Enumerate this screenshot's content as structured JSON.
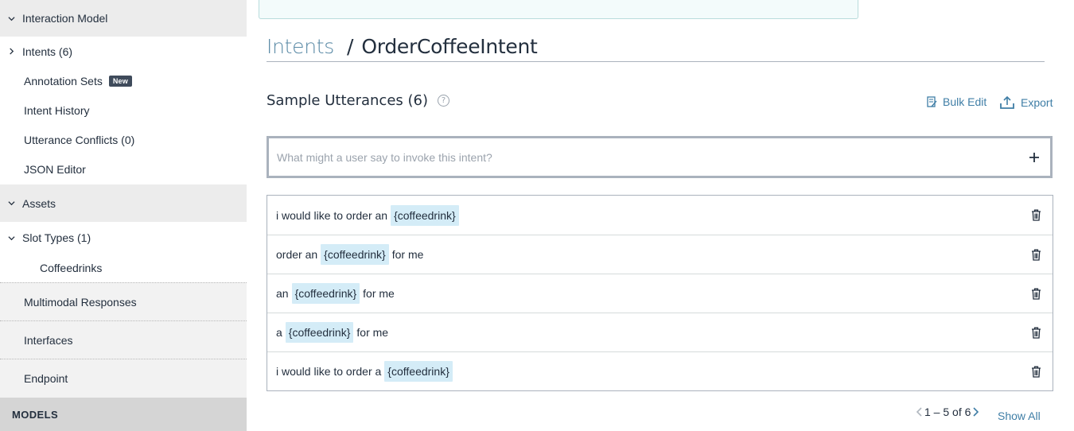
{
  "sidebar": {
    "interaction_model": "Interaction Model",
    "intents": "Intents (6)",
    "annotation_sets": "Annotation Sets",
    "new_badge": "New",
    "intent_history": "Intent History",
    "utterance_conflicts": "Utterance Conflicts (0)",
    "json_editor": "JSON Editor",
    "assets": "Assets",
    "slot_types": "Slot Types (1)",
    "coffeedrinks": "Coffeedrinks",
    "multimodal_responses": "Multimodal Responses",
    "interfaces": "Interfaces",
    "endpoint": "Endpoint",
    "models": "MODELS"
  },
  "breadcrumb": {
    "parent": "Intents",
    "separator": "/",
    "current": "OrderCoffeeIntent"
  },
  "utterances": {
    "title": "Sample Utterances (6)",
    "help": "?",
    "bulk_edit": "Bulk Edit",
    "export": "Export",
    "input_placeholder": "What might a user say to invoke this intent?",
    "add_symbol": "+",
    "rows": [
      {
        "before": "i would like to order an",
        "slot": "{coffeedrink}",
        "after": ""
      },
      {
        "before": "order an",
        "slot": "{coffeedrink}",
        "after": "for me"
      },
      {
        "before": "an",
        "slot": "{coffeedrink}",
        "after": "for me"
      },
      {
        "before": "a",
        "slot": "{coffeedrink}",
        "after": "for me"
      },
      {
        "before": "i would like to order a",
        "slot": "{coffeedrink}",
        "after": ""
      }
    ]
  },
  "pagination": {
    "range": "1 – 5 of 6",
    "show_all": "Show All"
  },
  "colors": {
    "accent_link": "#3f7ea6",
    "slot_highlight": "#d4ecf7",
    "sidebar_bg": "#f2f2f2"
  }
}
